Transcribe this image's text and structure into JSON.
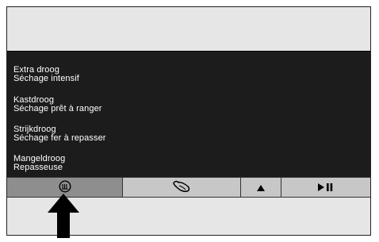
{
  "programs": [
    {
      "nl": "Extra droog",
      "fr": "Séchage intensif"
    },
    {
      "nl": "Kastdroog",
      "fr": "Séchage prêt à ranger"
    },
    {
      "nl": "Strijkdroog",
      "fr": "Séchage fer à repasser"
    },
    {
      "nl": "Mangeldroog",
      "fr": "Repasseuse"
    }
  ],
  "buttons": [
    {
      "icon": "heat-coil-icon",
      "active": true
    },
    {
      "icon": "wool-icon",
      "active": false
    },
    {
      "icon": "up-triangle-icon",
      "active": false
    },
    {
      "icon": "play-pause-icon",
      "active": false
    }
  ],
  "indicator": {
    "icon": "up-arrow-icon"
  },
  "colors": {
    "display_bg": "#1c1c1c",
    "button_bg": "#c7c7c7",
    "button_active_bg": "#8e8e8e",
    "panel_bg": "#e6e6e6"
  }
}
